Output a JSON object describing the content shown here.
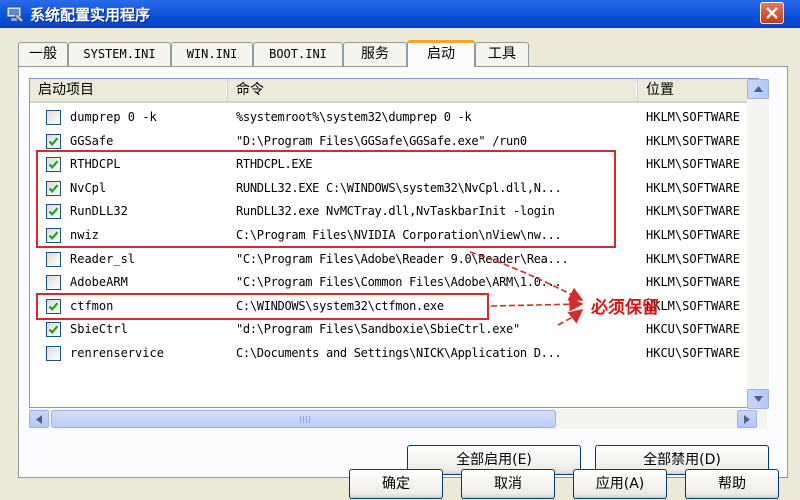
{
  "window": {
    "title": "系统配置实用程序"
  },
  "tabs": [
    {
      "label": "一般"
    },
    {
      "label": "SYSTEM.INI"
    },
    {
      "label": "WIN.INI"
    },
    {
      "label": "BOOT.INI"
    },
    {
      "label": "服务"
    },
    {
      "label": "启动"
    },
    {
      "label": "工具"
    }
  ],
  "active_tab": "启动",
  "list": {
    "columns": [
      "启动项目",
      "命令",
      "位置"
    ],
    "rows": [
      {
        "checked": false,
        "item": "dumprep 0 -k",
        "command": "%systemroot%\\system32\\dumprep 0 -k",
        "location": "HKLM\\SOFTWARE"
      },
      {
        "checked": true,
        "item": "GGSafe",
        "command": "\"D:\\Program Files\\GGSafe\\GGSafe.exe\" /run0",
        "location": "HKLM\\SOFTWARE"
      },
      {
        "checked": true,
        "item": "RTHDCPL",
        "command": "RTHDCPL.EXE",
        "location": "HKLM\\SOFTWARE"
      },
      {
        "checked": true,
        "item": "NvCpl",
        "command": "RUNDLL32.EXE C:\\WINDOWS\\system32\\NvCpl.dll,N...",
        "location": "HKLM\\SOFTWARE"
      },
      {
        "checked": true,
        "item": "RunDLL32",
        "command": "RunDLL32.exe NvMCTray.dll,NvTaskbarInit -login",
        "location": "HKLM\\SOFTWARE"
      },
      {
        "checked": true,
        "item": "nwiz",
        "command": "C:\\Program Files\\NVIDIA Corporation\\nView\\nw...",
        "location": "HKLM\\SOFTWARE"
      },
      {
        "checked": false,
        "item": "Reader_sl",
        "command": "\"C:\\Program Files\\Adobe\\Reader 9.0\\Reader\\Rea...",
        "location": "HKLM\\SOFTWARE"
      },
      {
        "checked": false,
        "item": "AdobeARM",
        "command": "\"C:\\Program Files\\Common Files\\Adobe\\ARM\\1.0...",
        "location": "HKLM\\SOFTWARE"
      },
      {
        "checked": true,
        "item": "ctfmon",
        "command": "C:\\WINDOWS\\system32\\ctfmon.exe",
        "location": "HKLM\\SOFTWARE"
      },
      {
        "checked": true,
        "item": "SbieCtrl",
        "command": "\"d:\\Program Files\\Sandboxie\\SbieCtrl.exe\"",
        "location": "HKCU\\SOFTWARE"
      },
      {
        "checked": false,
        "item": "renrenservice",
        "command": "C:\\Documents and Settings\\NICK\\Application D...",
        "location": "HKCU\\SOFTWARE"
      }
    ]
  },
  "buttons": {
    "enable_all": "全部启用(E)",
    "disable_all": "全部禁用(D)",
    "ok": "确定",
    "cancel": "取消",
    "apply": "应用(A)",
    "help": "帮助"
  },
  "annotation": {
    "text": "必须保留",
    "color": "#d42b2b"
  },
  "colors": {
    "titlebar": "#0a4fd6",
    "window_bg": "#ece9d8",
    "active_tab_accent": "#f5a623"
  }
}
